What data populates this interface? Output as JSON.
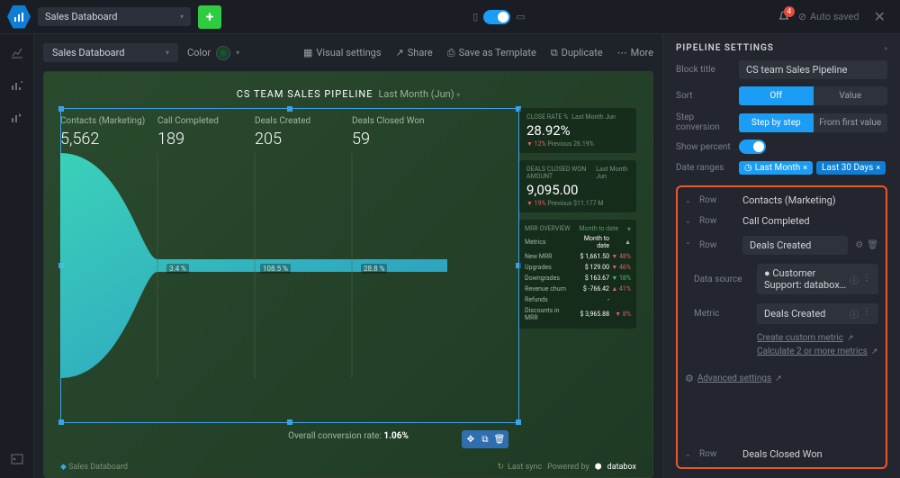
{
  "header": {
    "title": "Sales Databoard",
    "auto_saved": "Auto saved",
    "notifications": "4"
  },
  "toolbar": {
    "board_name": "Sales Databoard",
    "color_label": "Color",
    "visual_settings": "Visual settings",
    "share": "Share",
    "save_template": "Save as Template",
    "duplicate": "Duplicate",
    "more": "More"
  },
  "board": {
    "title": "CS TEAM SALES PIPELINE",
    "period": "Last Month (Jun)",
    "overall_label": "Overall conversion rate:",
    "overall_value": "1.06%",
    "footer_name": "Sales Databoard",
    "last_sync": "Last sync",
    "powered": "Powered by",
    "brand": "databox",
    "funnel": [
      {
        "label": "Contacts (Marketing)",
        "value": "5,562"
      },
      {
        "label": "Call Completed",
        "value": "189"
      },
      {
        "label": "Deals Created",
        "value": "205"
      },
      {
        "label": "Deals Closed Won",
        "value": "59"
      }
    ],
    "pct": [
      "3.4 %",
      "108.5 %",
      "28.8 %"
    ],
    "card_rate": {
      "title": "CLOSE RATE %",
      "sub": "Last Month Jun",
      "value": "28.92%",
      "delta": "12%",
      "prev": "Previous 26.19%"
    },
    "card_amount": {
      "title": "DEALS CLOSED WON AMOUNT",
      "sub": "Last Month Jun",
      "value": "9,095.00",
      "delta": "19%",
      "prev": "Previous $11.177 M"
    },
    "card_mrr": {
      "title": "MRR OVERVIEW",
      "sub": "Month to date",
      "cols": [
        "Metrics",
        "Month to date",
        ""
      ],
      "rows": [
        {
          "m": "New MRR",
          "v": "$ 1,661.50",
          "d": "▼ 48%",
          "c": "down"
        },
        {
          "m": "Upgrades",
          "v": "$ 129.00",
          "d": "▼ 46%",
          "c": "down"
        },
        {
          "m": "Downgrades",
          "v": "$ 163.67",
          "d": "▼ 18%",
          "c": "up"
        },
        {
          "m": "Revenue churn",
          "v": "$ -766.42",
          "d": "▲ 41%",
          "c": "down"
        },
        {
          "m": "Refunds",
          "v": "-",
          "d": "",
          "c": ""
        },
        {
          "m": "Discounts in MRR",
          "v": "$ 3,965.88",
          "d": "▼ 8%",
          "c": "down"
        }
      ]
    }
  },
  "panel": {
    "heading": "PIPELINE SETTINGS",
    "block_title_label": "Block title",
    "block_title": "CS team Sales Pipeline",
    "sort_label": "Sort",
    "sort_options": [
      "Off",
      "Value"
    ],
    "step_label": "Step conversion",
    "step_options": [
      "Step by step",
      "From first value"
    ],
    "show_percent": "Show percent",
    "date_ranges_label": "Date ranges",
    "chips": [
      "Last Month",
      "Last 30 Days"
    ],
    "rows": [
      {
        "label": "Row",
        "value": "Contacts (Marketing)"
      },
      {
        "label": "Row",
        "value": "Call Completed"
      },
      {
        "label": "Row",
        "value": "Deals Created",
        "expanded": true
      },
      {
        "label": "Row",
        "value": "Deals Closed Won"
      }
    ],
    "data_source_label": "Data source",
    "data_source": "Customer Support: databox…",
    "metric_label": "Metric",
    "metric": "Deals Created",
    "create_metric": "Create custom metric",
    "calc_metric": "Calculate 2 or more metrics",
    "advanced": "Advanced settings"
  },
  "chart_data": {
    "type": "bar",
    "title": "CS Team Sales Pipeline — Last Month (Jun)",
    "categories": [
      "Contacts (Marketing)",
      "Call Completed",
      "Deals Created",
      "Deals Closed Won"
    ],
    "values": [
      5562,
      189,
      205,
      59
    ],
    "step_conversion_pct": [
      3.4,
      108.5,
      28.8
    ],
    "overall_conversion_pct": 1.06,
    "kpis": {
      "close_rate_pct": 28.92,
      "close_rate_delta_pct": -12,
      "close_rate_prev_pct": 26.19,
      "deals_closed_won_amount": 9095.0,
      "deals_closed_won_delta_pct": -19,
      "deals_closed_won_prev": 11177000
    },
    "mrr_month_to_date": {
      "New MRR": 1661.5,
      "Upgrades": 129.0,
      "Downgrades": 163.67,
      "Revenue churn": -766.42,
      "Refunds": null,
      "Discounts in MRR": 3965.88
    }
  }
}
